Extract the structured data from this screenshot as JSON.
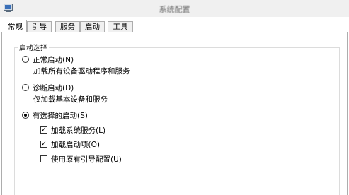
{
  "window": {
    "title": "系统配置"
  },
  "tabs": [
    {
      "label": "常规",
      "active": true
    },
    {
      "label": "引导",
      "active": false
    },
    {
      "label": "服务",
      "active": false
    },
    {
      "label": "启动",
      "active": false
    },
    {
      "label": "工具",
      "active": false
    }
  ],
  "startup_group": {
    "legend": "启动选择",
    "normal": {
      "label": "正常启动(N)",
      "description": "加载所有设备驱动程序和服务",
      "selected": false
    },
    "diagnostic": {
      "label": "诊断启动(D)",
      "description": "仅加载基本设备和服务",
      "selected": false
    },
    "selective": {
      "label": "有选择的启动(S)",
      "selected": true,
      "options": [
        {
          "label": "加载系统服务(L)",
          "checked": true,
          "mark": "✓"
        },
        {
          "label": "加载启动项(O)",
          "checked": true,
          "mark": "✓"
        },
        {
          "label": "使用原有引导配置(U)",
          "checked": false,
          "mark": ""
        }
      ]
    }
  },
  "icons": {
    "app": "msconfig-icon"
  }
}
